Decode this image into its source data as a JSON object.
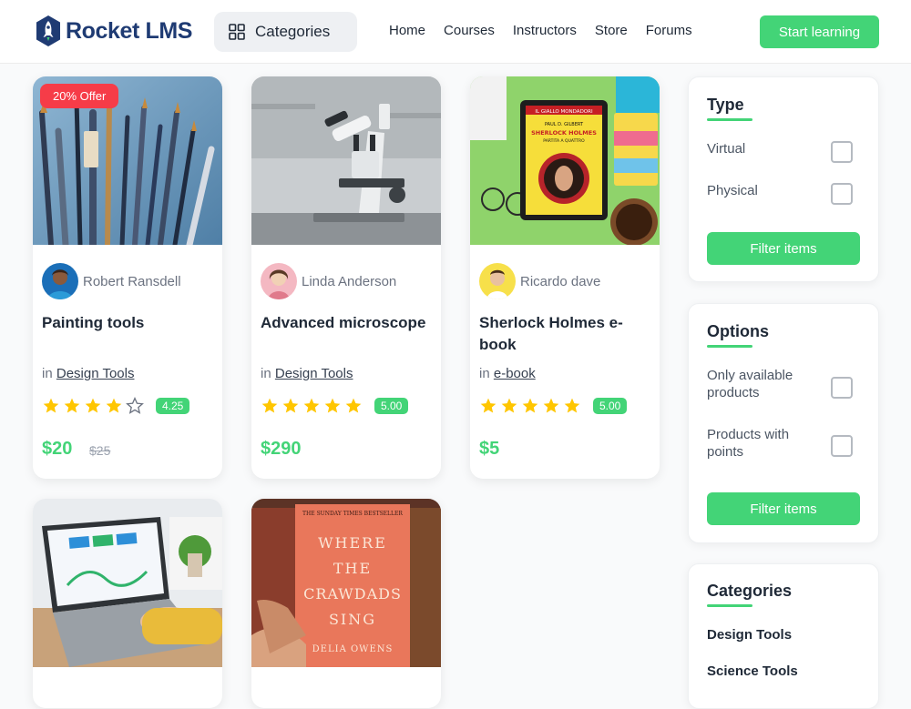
{
  "header": {
    "logo_text": "Rocket LMS",
    "categories_label": "Categories",
    "nav": [
      "Home",
      "Courses",
      "Instructors",
      "Store",
      "Forums"
    ],
    "cta": "Start learning",
    "accent": "#43d477"
  },
  "products": [
    {
      "offer": "20% Offer",
      "author": "Robert Ransdell",
      "title": "Painting tools",
      "in_prefix": "in",
      "category": "Design Tools",
      "stars": 4,
      "rating": "4.25",
      "price": "$20",
      "old_price": "$25",
      "image": "paintbrushes"
    },
    {
      "offer": "",
      "author": "Linda Anderson",
      "title": "Advanced microscope",
      "in_prefix": "in",
      "category": "Design Tools",
      "stars": 5,
      "rating": "5.00",
      "price": "$290",
      "old_price": "",
      "image": "microscope"
    },
    {
      "offer": "",
      "author": "Ricardo dave",
      "title": "Sherlock Holmes e-book",
      "in_prefix": "in",
      "category": "e-book",
      "stars": 5,
      "rating": "5.00",
      "price": "$5",
      "old_price": "",
      "image": "tablet-ebook"
    },
    {
      "image": "laptop-dashboard"
    },
    {
      "image": "book-cover",
      "book_lines": [
        "WHERE",
        "THE",
        "CRAWDADS",
        "SING"
      ],
      "book_top": "THE SUNDAY TIMES BESTSELLER",
      "book_author": "DELIA OWENS"
    }
  ],
  "ebook_cover": {
    "publisher": "IL GIALLO MONDADORI",
    "author": "PAUL D. GILBERT",
    "title": "SHERLOCK HOLMES",
    "subtitle": "PARTITA A QUATTRO"
  },
  "sidebar": {
    "type": {
      "title": "Type",
      "options": [
        "Virtual",
        "Physical"
      ],
      "button": "Filter items"
    },
    "options": {
      "title": "Options",
      "options": [
        "Only available products",
        "Products with points"
      ],
      "button": "Filter items"
    },
    "categories": {
      "title": "Categories",
      "items": [
        "Design Tools",
        "Science Tools"
      ]
    }
  }
}
